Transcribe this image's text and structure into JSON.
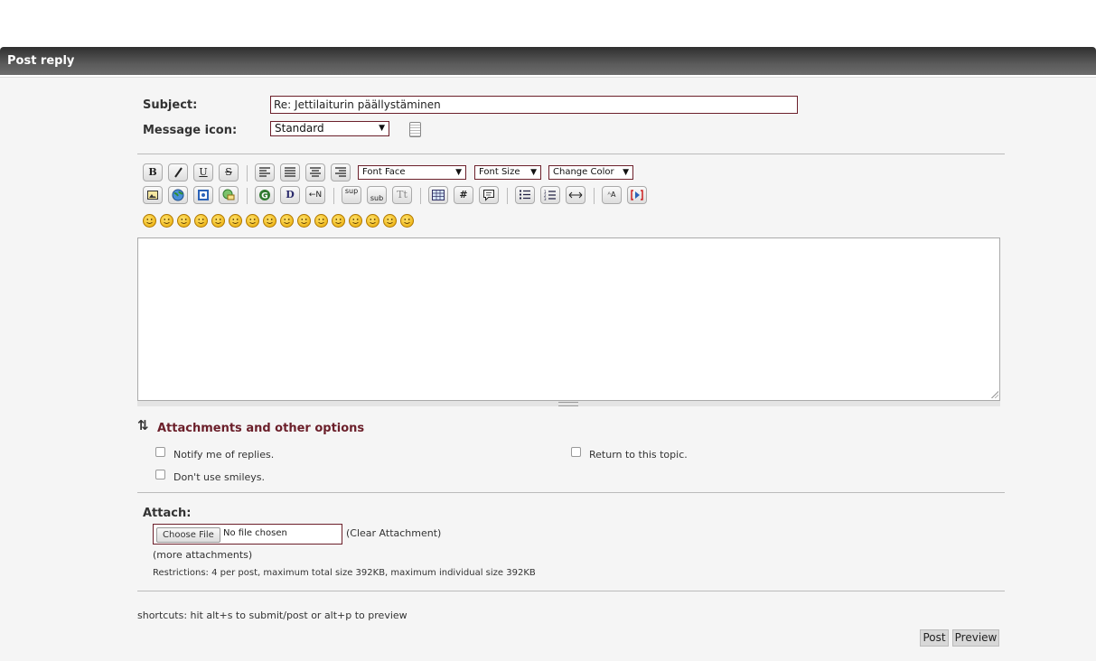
{
  "header": {
    "title": "Post reply"
  },
  "subject": {
    "label": "Subject:",
    "value": "Re: Jettilaiturin päällystäminen"
  },
  "message_icon": {
    "label": "Message icon:",
    "selected": "Standard"
  },
  "toolbar": {
    "font_face": "Font Face",
    "font_size": "Font Size",
    "change_color": "Change Color",
    "bold": "B",
    "underline": "U",
    "strike": "S",
    "sup": "sup",
    "sub": "sub",
    "teletype": "Tt",
    "hash": "#"
  },
  "smileys_count": 16,
  "attachments": {
    "heading": "Attachments and other options",
    "notify": "Notify me of replies.",
    "return_topic": "Return to this topic.",
    "no_smileys": "Don't use smileys."
  },
  "attach": {
    "label": "Attach:",
    "choose_file": "Choose File",
    "no_file": "No file chosen",
    "clear": "(Clear Attachment)",
    "more": "(more attachments)",
    "restrictions": "Restrictions: 4 per post, maximum total size 392KB, maximum individual size 392KB"
  },
  "shortcuts": "shortcuts: hit alt+s to submit/post or alt+p to preview",
  "buttons": {
    "post": "Post",
    "preview": "Preview"
  },
  "colors": {
    "accent": "#6b1f2a",
    "header_dark": "#2f2f2f"
  }
}
